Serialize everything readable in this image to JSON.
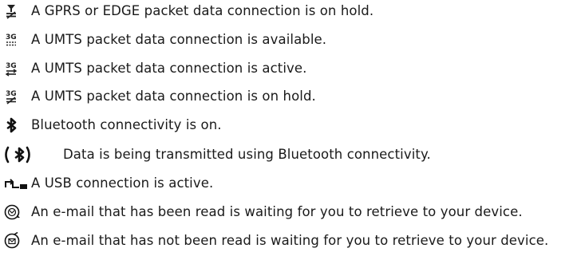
{
  "items": [
    {
      "icon": "gprs-edge-on-hold-icon",
      "text": "A GPRS or EDGE packet data connection is on hold."
    },
    {
      "icon": "umts-available-icon",
      "text": "A UMTS packet data connection is available."
    },
    {
      "icon": "umts-active-icon",
      "text": "A UMTS packet data connection is active."
    },
    {
      "icon": "umts-on-hold-icon",
      "text": "A UMTS packet data connection is on hold."
    },
    {
      "icon": "bluetooth-icon",
      "text": "Bluetooth connectivity is on."
    },
    {
      "icon": "bluetooth-transmitting-icon",
      "text": "Data is being transmitted using Bluetooth connectivity."
    },
    {
      "icon": "usb-icon",
      "text": "A USB connection is active."
    },
    {
      "icon": "email-read-icon",
      "text": "An e-mail that has been read is waiting for you to retrieve to your device."
    },
    {
      "icon": "email-unread-icon",
      "text": "An e-mail that has not been read is waiting for you to retrieve to your device."
    }
  ]
}
